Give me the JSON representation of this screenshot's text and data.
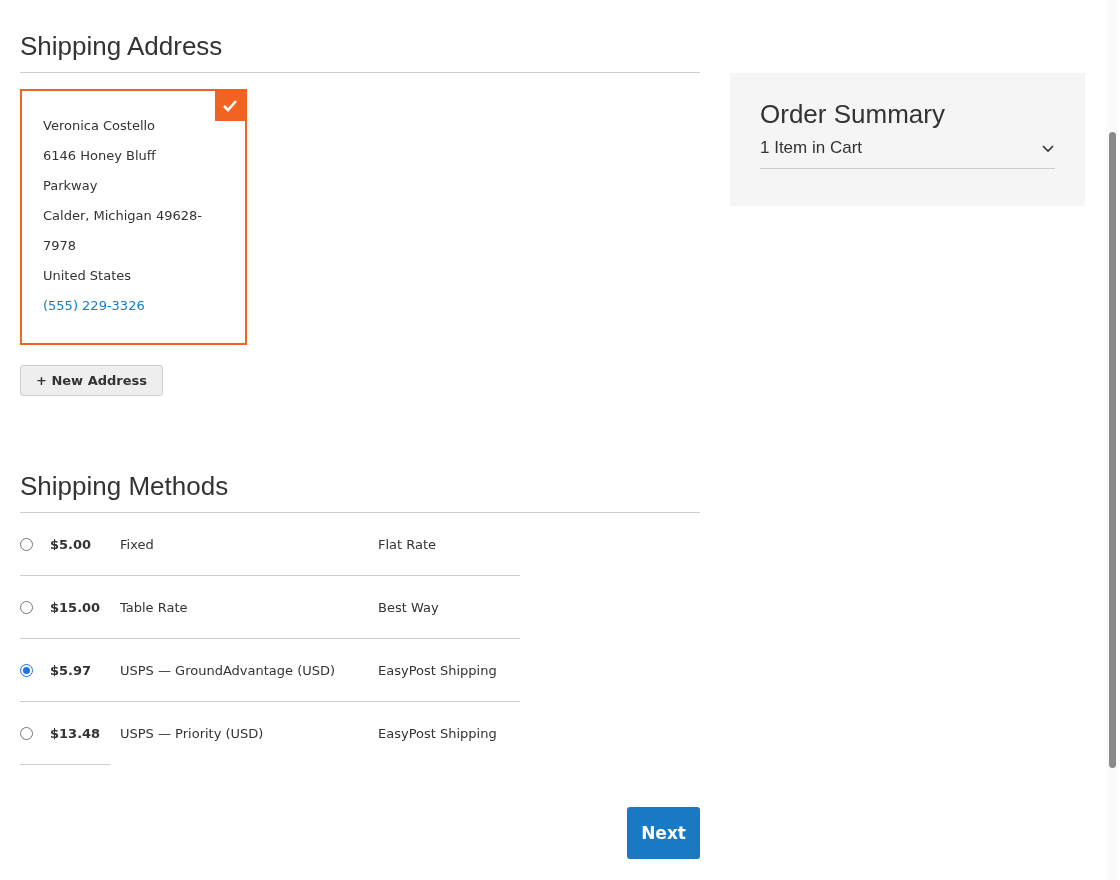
{
  "shipping_address": {
    "title": "Shipping Address",
    "address_card": {
      "selected": true,
      "lines": [
        "Veronica Costello",
        "6146 Honey Bluff",
        "Parkway",
        "Calder, Michigan 49628-",
        "7978",
        "United States"
      ],
      "phone": "(555) 229-3326"
    },
    "new_address_button": "+ New Address"
  },
  "shipping_methods": {
    "title": "Shipping Methods",
    "rows": [
      {
        "price": "$5.00",
        "method": "Fixed",
        "carrier": "Flat Rate",
        "selected": false
      },
      {
        "price": "$15.00",
        "method": "Table Rate",
        "carrier": "Best Way",
        "selected": false
      },
      {
        "price": "$5.97",
        "method": "USPS — GroundAdvantage (USD)",
        "carrier": "EasyPost Shipping",
        "selected": true
      },
      {
        "price": "$13.48",
        "method": "USPS — Priority (USD)",
        "carrier": "EasyPost Shipping",
        "selected": false
      }
    ]
  },
  "next_button": "Next",
  "order_summary": {
    "title": "Order Summary",
    "cart_label": "1 Item in Cart",
    "expanded": false
  }
}
